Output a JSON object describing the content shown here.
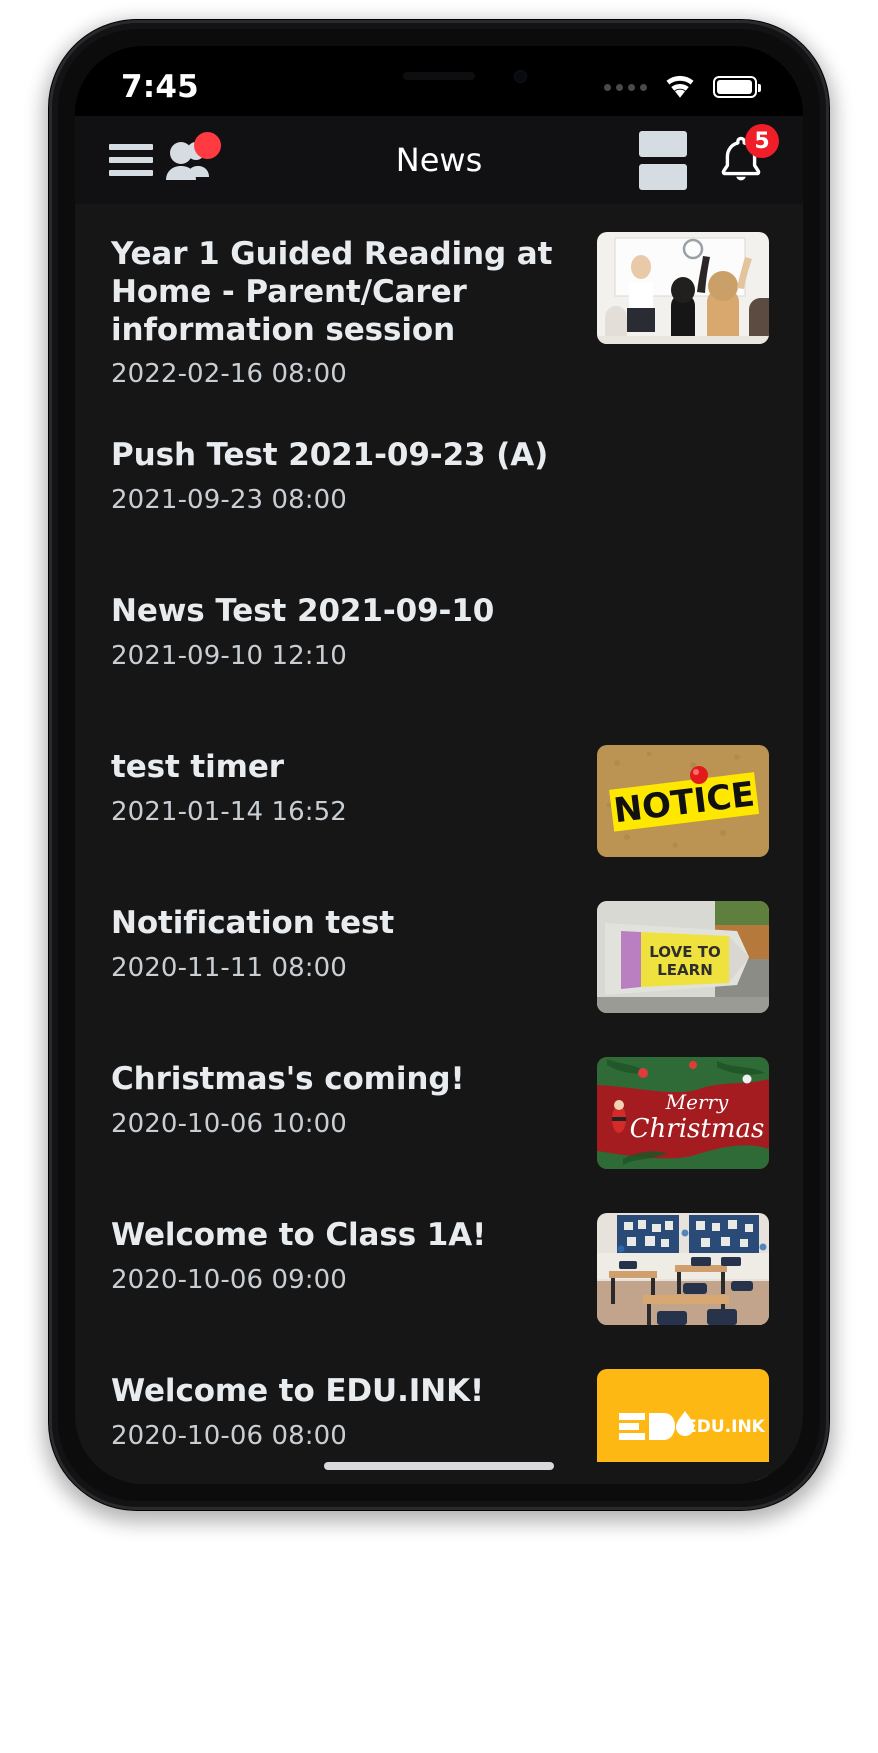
{
  "status_bar": {
    "time": "7:45",
    "signal_icon": "signal-dots-icon",
    "wifi_icon": "wifi-icon",
    "battery_icon": "battery-icon"
  },
  "app_bar": {
    "title": "News",
    "menu_icon": "hamburger-menu-icon",
    "people_icon": "people-group-icon",
    "people_badge": "",
    "layout_icon": "stacked-layout-icon",
    "bell_icon": "notification-bell-icon",
    "bell_badge": "5"
  },
  "theme": {
    "screen_bg": "#000000",
    "appbar_bg": "#111113",
    "content_bg": "#161617",
    "title_color": "#e9ecef",
    "date_color": "#c9ced3",
    "badge_red": "#f01e28",
    "dot_red": "#ff3b41",
    "icon_grey": "#d6dde2",
    "brand_yellow": "#fdb813"
  },
  "news": {
    "items": [
      {
        "title": "Year 1 Guided Reading at Home - Parent/Carer information session",
        "date": "2022-02-16 08:00",
        "thumb": "classroom-hands-raised-photo"
      },
      {
        "title": "Push Test 2021-09-23 (A)",
        "date": "2021-09-23 08:00",
        "thumb": ""
      },
      {
        "title": "News Test 2021-09-10",
        "date": "2021-09-10 12:10",
        "thumb": ""
      },
      {
        "title": "test timer",
        "date": "2021-01-14 16:52",
        "thumb": "notice-corkboard-photo"
      },
      {
        "title": "Notification test",
        "date": "2020-11-11 08:00",
        "thumb": "love-to-learn-pencil-photo"
      },
      {
        "title": "Christmas's coming!",
        "date": "2020-10-06 10:00",
        "thumb": "merry-christmas-photo"
      },
      {
        "title": "Welcome to Class 1A!",
        "date": "2020-10-06 09:00",
        "thumb": "empty-classroom-photo"
      },
      {
        "title": "Welcome to EDU.INK!",
        "date": "2020-10-06 08:00",
        "thumb": "eduink-logo-tile"
      }
    ]
  },
  "thumb_text": {
    "notice_label": "NOTICE",
    "pencil_line1": "LOVE TO",
    "pencil_line2": "LEARN",
    "christmas_line1": "Merry",
    "christmas_line2": "Christmas",
    "eduink_mark": "EDU",
    "eduink_name": "EDU.INK"
  }
}
